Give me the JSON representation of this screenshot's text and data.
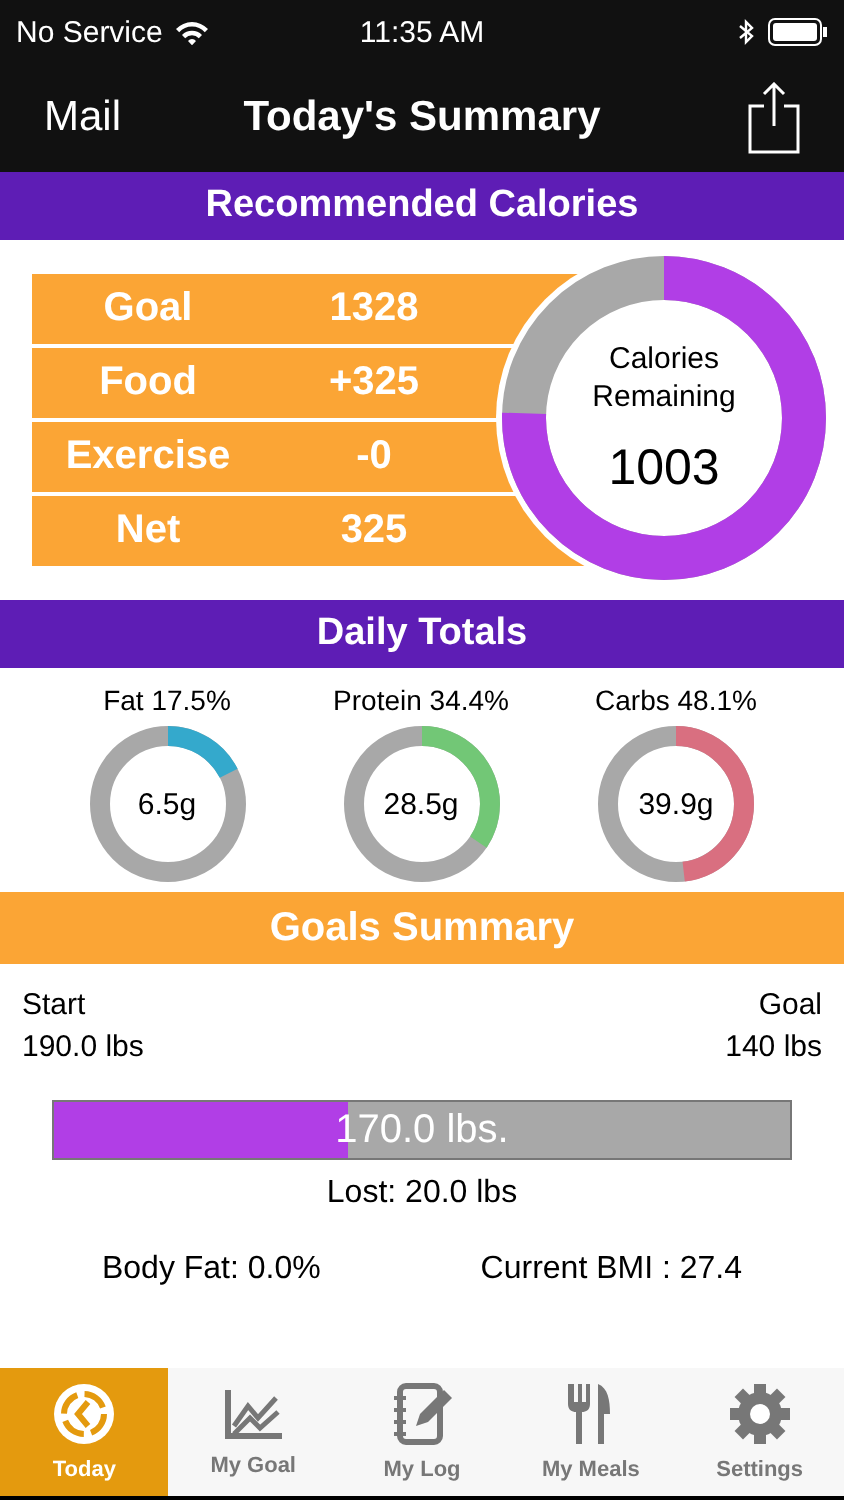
{
  "status_bar": {
    "carrier": "No Service",
    "time": "11:35 AM"
  },
  "nav_bar": {
    "back": "Mail",
    "title": "Today's Summary"
  },
  "calories": {
    "header": "Recommended Calories",
    "rows": [
      {
        "label": "Goal",
        "value": "1328"
      },
      {
        "label": "Food",
        "value": "+325"
      },
      {
        "label": "Exercise",
        "value": "-0"
      },
      {
        "label": "Net",
        "value": "325"
      }
    ],
    "ring": {
      "label": "Calories Remaining",
      "value": "1003",
      "level": 0.755
    }
  },
  "daily_totals": {
    "header": "Daily Totals",
    "macros": [
      {
        "label": "Fat 17.5%",
        "value": "6.5g",
        "level": 0.175,
        "color": "#34a9cc"
      },
      {
        "label": "Protein 34.4%",
        "value": "28.5g",
        "level": 0.344,
        "color": "#72c776"
      },
      {
        "label": "Carbs 48.1%",
        "value": "39.9g",
        "level": 0.481,
        "color": "#d96f80"
      }
    ]
  },
  "goals_summary": {
    "header": "Goals Summary",
    "start_label": "Start",
    "start_value": "190.0 lbs",
    "goal_label": "Goal",
    "goal_value": "140 lbs",
    "progress": {
      "text": "170.0 lbs.",
      "level": 0.4
    },
    "lost": "Lost:  20.0 lbs",
    "body_fat": "Body Fat:  0.0%",
    "bmi": "Current BMI : 27.4"
  },
  "tab_bar": [
    {
      "label": "Today",
      "selected": true
    },
    {
      "label": "My Goal",
      "selected": false
    },
    {
      "label": "My Log",
      "selected": false
    },
    {
      "label": "My Meals",
      "selected": false
    },
    {
      "label": "Settings",
      "selected": false
    }
  ]
}
